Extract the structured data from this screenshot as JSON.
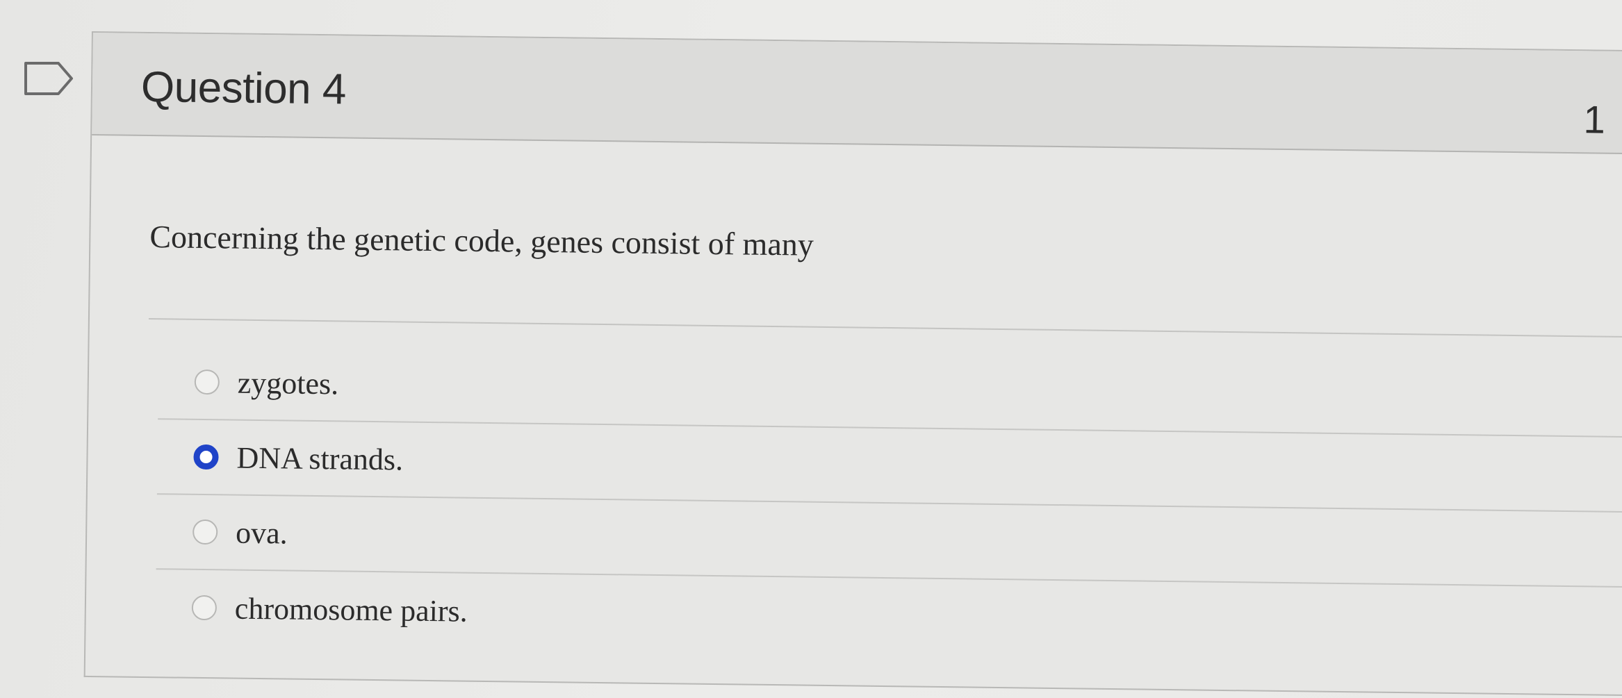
{
  "question": {
    "title": "Question 4",
    "points": "1",
    "text": "Concerning the genetic code, genes consist of many",
    "answers": [
      {
        "label": "zygotes.",
        "selected": false
      },
      {
        "label": "DNA strands.",
        "selected": true
      },
      {
        "label": "ova.",
        "selected": false
      },
      {
        "label": "chromosome pairs.",
        "selected": false
      }
    ]
  },
  "colors": {
    "selected_radio": "#1f43c8",
    "header_bg": "#dcdcda"
  },
  "icons": {
    "flag": "flag-question-icon"
  }
}
